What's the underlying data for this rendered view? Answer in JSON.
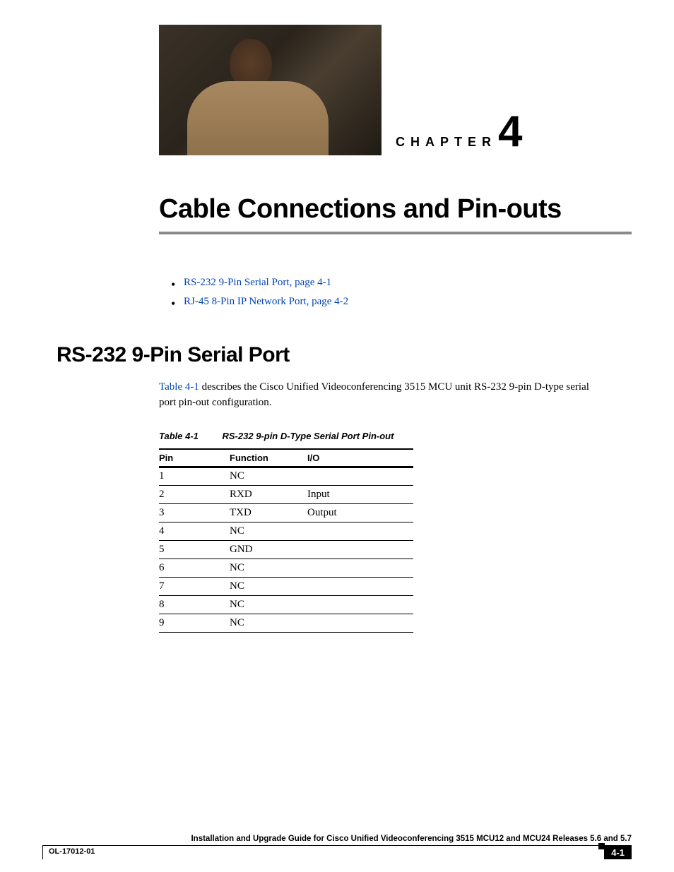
{
  "chapter": {
    "label": "CHAPTER",
    "number": "4"
  },
  "title": "Cable Connections and Pin-outs",
  "toc": [
    "RS-232 9-Pin Serial Port, page 4-1",
    "RJ-45 8-Pin IP Network Port, page 4-2"
  ],
  "section": {
    "heading": "RS-232 9-Pin Serial Port",
    "intro_link": "Table 4-1",
    "intro_rest": " describes the Cisco Unified Videoconferencing 3515 MCU unit RS-232 9-pin D-type serial port pin-out configuration."
  },
  "table": {
    "number": "Table 4-1",
    "title": "RS-232 9-pin D-Type Serial Port Pin-out",
    "headers": {
      "pin": "Pin",
      "fn": "Function",
      "io": "I/O"
    },
    "rows": [
      {
        "pin": "1",
        "fn": "NC",
        "io": ""
      },
      {
        "pin": "2",
        "fn": "RXD",
        "io": "Input"
      },
      {
        "pin": "3",
        "fn": "TXD",
        "io": "Output"
      },
      {
        "pin": "4",
        "fn": "NC",
        "io": ""
      },
      {
        "pin": "5",
        "fn": "GND",
        "io": ""
      },
      {
        "pin": "6",
        "fn": "NC",
        "io": ""
      },
      {
        "pin": "7",
        "fn": "NC",
        "io": ""
      },
      {
        "pin": "8",
        "fn": "NC",
        "io": ""
      },
      {
        "pin": "9",
        "fn": "NC",
        "io": ""
      }
    ]
  },
  "footer": {
    "guide": "Installation and Upgrade Guide for Cisco Unified Videoconferencing 3515 MCU12 and MCU24 Releases 5.6 and 5.7",
    "docnum": "OL-17012-01",
    "page": "4-1"
  }
}
